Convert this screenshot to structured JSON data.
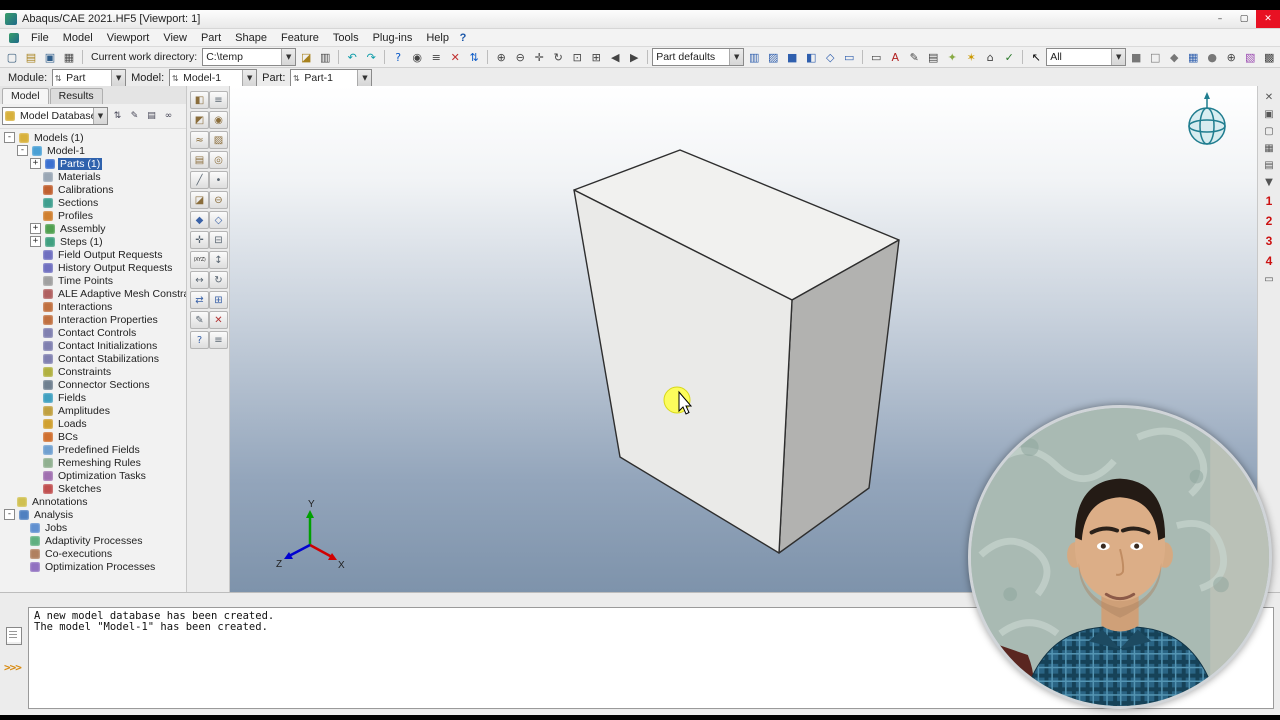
{
  "window": {
    "title": "Abaqus/CAE 2021.HF5 [Viewport: 1]",
    "buttons": {
      "minimize": "–",
      "maximize": "▢",
      "close": "✕"
    }
  },
  "menu": {
    "items": [
      "File",
      "Model",
      "Viewport",
      "View",
      "Part",
      "Shape",
      "Feature",
      "Tools",
      "Plug-ins",
      "Help"
    ],
    "help_glyph": "?"
  },
  "toolbar": {
    "work_dir_label": "Current work directory:",
    "work_dir_value": "C:\\temp",
    "render_combo": "Part defaults",
    "selection_combo": "All",
    "g1": [
      {
        "name": "new-model-icon",
        "glyph": "▢",
        "c": "#355a7a"
      },
      {
        "name": "open-model-icon",
        "glyph": "▤",
        "c": "#a8821e"
      },
      {
        "name": "save-model-icon",
        "glyph": "▣",
        "c": "#2e5d8a"
      },
      {
        "name": "print-icon",
        "glyph": "▦",
        "c": "#4a4a4a"
      }
    ],
    "g2": [
      {
        "name": "set-work-directory-icon",
        "glyph": "◪",
        "c": "#a8821e"
      },
      {
        "name": "print-viewport-icon",
        "glyph": "▥",
        "c": "#4a4a4a"
      }
    ],
    "g3": [
      {
        "name": "undo-icon",
        "glyph": "↶",
        "c": "#0a9ba8"
      },
      {
        "name": "redo-icon",
        "glyph": "↷",
        "c": "#0a9ba8"
      }
    ],
    "g4": [
      {
        "name": "query-icon",
        "glyph": "?",
        "c": "#0a5ac8"
      },
      {
        "name": "probe-icon",
        "glyph": "◉",
        "c": "#444444"
      },
      {
        "name": "reference-icon",
        "glyph": "≡",
        "c": "#444444"
      },
      {
        "name": "delete-icon",
        "glyph": "✕",
        "c": "#c03030"
      },
      {
        "name": "refresh-icon",
        "glyph": "⇅",
        "c": "#0a5ac8"
      }
    ],
    "g5": [
      {
        "name": "magnify-icon",
        "glyph": "⊕",
        "c": "#444444"
      },
      {
        "name": "demagnify-icon",
        "glyph": "⊖",
        "c": "#444444"
      },
      {
        "name": "pan-icon",
        "glyph": "✛",
        "c": "#444444"
      },
      {
        "name": "rotate-view-icon",
        "glyph": "↻",
        "c": "#444444"
      },
      {
        "name": "box-zoom-icon",
        "glyph": "⊡",
        "c": "#444444"
      },
      {
        "name": "fit-view-icon",
        "glyph": "⊞",
        "c": "#444444"
      },
      {
        "name": "cycle-prev-icon",
        "glyph": "◀",
        "c": "#444444"
      },
      {
        "name": "cycle-next-icon",
        "glyph": "▶",
        "c": "#444444"
      }
    ],
    "g6": [
      {
        "name": "wireframe-render-icon",
        "glyph": "▥",
        "c": "#2f5fae"
      },
      {
        "name": "hidden-render-icon",
        "glyph": "▨",
        "c": "#2f5fae"
      },
      {
        "name": "shaded-render-icon",
        "glyph": "■",
        "c": "#2f5fae"
      },
      {
        "name": "cut-view-icon",
        "glyph": "◧",
        "c": "#2f5fae"
      },
      {
        "name": "perspective-icon",
        "glyph": "◇",
        "c": "#2f5fae"
      },
      {
        "name": "parallel-icon",
        "glyph": "▭",
        "c": "#2f5fae"
      }
    ],
    "g7": [
      {
        "name": "viewport-icon",
        "glyph": "▭",
        "c": "#444444"
      },
      {
        "name": "annotation-icon",
        "glyph": "A",
        "c": "#b22222"
      },
      {
        "name": "text-icon",
        "glyph": "✎",
        "c": "#444444"
      },
      {
        "name": "overlay-icon",
        "glyph": "▤",
        "c": "#444444"
      },
      {
        "name": "sweep-icon",
        "glyph": "✦",
        "c": "#88aa44"
      },
      {
        "name": "lights-icon",
        "glyph": "✶",
        "c": "#cc9900"
      },
      {
        "name": "views-icon",
        "glyph": "⌂",
        "c": "#444444"
      },
      {
        "name": "snap-icon",
        "glyph": "✓",
        "c": "#2a7a2a"
      }
    ],
    "pointer": {
      "name": "pointer-icon",
      "glyph": "↖",
      "c": "#000000"
    },
    "g8": [
      {
        "name": "select-entity-icon",
        "glyph": "■",
        "c": "#777777"
      },
      {
        "name": "select-box-icon",
        "glyph": "□",
        "c": "#777777"
      },
      {
        "name": "select-angle-icon",
        "glyph": "◆",
        "c": "#777777"
      },
      {
        "name": "mesh-display-icon",
        "glyph": "▦",
        "c": "#2f5fae"
      },
      {
        "name": "highlight-icon",
        "glyph": "●",
        "c": "#777777"
      },
      {
        "name": "add-icon",
        "glyph": "⊕",
        "c": "#444444"
      },
      {
        "name": "color-code-icon",
        "glyph": "▧",
        "c": "#9a4ab0"
      },
      {
        "name": "pattern-icon",
        "glyph": "▩",
        "c": "#444444"
      },
      {
        "name": "plus-icon",
        "glyph": "✚",
        "c": "#2a7a2a"
      },
      {
        "name": "display-group-icon",
        "glyph": "▣",
        "c": "#555555"
      }
    ]
  },
  "modulebar": {
    "module_label": "Module:",
    "module_value": "Part",
    "model_label": "Model:",
    "model_value": "Model-1",
    "part_label": "Part:",
    "part_value": "Part-1"
  },
  "left_panel": {
    "tabs": [
      {
        "label": "Model",
        "active": "true"
      },
      {
        "label": "Results",
        "active": "false"
      }
    ],
    "db_combo": "Model Database",
    "header_icons": [
      {
        "name": "spin-icon",
        "glyph": "⇅"
      },
      {
        "name": "edit-icon",
        "glyph": "✎"
      },
      {
        "name": "options-icon",
        "glyph": "▤"
      },
      {
        "name": "search-icon",
        "glyph": "∞"
      }
    ],
    "tree": [
      {
        "label": "Models (1)",
        "depth": "0",
        "exp": "-",
        "icon": "models",
        "selected": "false"
      },
      {
        "label": "Model-1",
        "depth": "1",
        "exp": "-",
        "icon": "model",
        "selected": "false"
      },
      {
        "label": "Parts (1)",
        "depth": "2",
        "exp": "+",
        "icon": "parts",
        "selected": "true"
      },
      {
        "label": "Materials",
        "depth": "2",
        "exp": "",
        "icon": "materials",
        "selected": "false"
      },
      {
        "label": "Calibrations",
        "depth": "2",
        "exp": "",
        "icon": "calibrations",
        "selected": "false"
      },
      {
        "label": "Sections",
        "depth": "2",
        "exp": "",
        "icon": "sections",
        "selected": "false"
      },
      {
        "label": "Profiles",
        "depth": "2",
        "exp": "",
        "icon": "profiles",
        "selected": "false"
      },
      {
        "label": "Assembly",
        "depth": "2",
        "exp": "+",
        "icon": "assembly",
        "selected": "false"
      },
      {
        "label": "Steps (1)",
        "depth": "2",
        "exp": "+",
        "icon": "steps",
        "selected": "false"
      },
      {
        "label": "Field Output Requests",
        "depth": "2",
        "exp": "",
        "icon": "field-output",
        "selected": "false"
      },
      {
        "label": "History Output Requests",
        "depth": "2",
        "exp": "",
        "icon": "history-output",
        "selected": "false"
      },
      {
        "label": "Time Points",
        "depth": "2",
        "exp": "",
        "icon": "time-points",
        "selected": "false"
      },
      {
        "label": "ALE Adaptive Mesh Constraints",
        "depth": "2",
        "exp": "",
        "icon": "ale",
        "selected": "false"
      },
      {
        "label": "Interactions",
        "depth": "2",
        "exp": "",
        "icon": "interactions",
        "selected": "false"
      },
      {
        "label": "Interaction Properties",
        "depth": "2",
        "exp": "",
        "icon": "interaction-props",
        "selected": "false"
      },
      {
        "label": "Contact Controls",
        "depth": "2",
        "exp": "",
        "icon": "contact-controls",
        "selected": "false"
      },
      {
        "label": "Contact Initializations",
        "depth": "2",
        "exp": "",
        "icon": "contact-init",
        "selected": "false"
      },
      {
        "label": "Contact Stabilizations",
        "depth": "2",
        "exp": "",
        "icon": "contact-stab",
        "selected": "false"
      },
      {
        "label": "Constraints",
        "depth": "2",
        "exp": "",
        "icon": "constraints",
        "selected": "false"
      },
      {
        "label": "Connector Sections",
        "depth": "2",
        "exp": "",
        "icon": "connector-sections",
        "selected": "false"
      },
      {
        "label": "Fields",
        "depth": "2",
        "exp": "",
        "icon": "fields",
        "selected": "false"
      },
      {
        "label": "Amplitudes",
        "depth": "2",
        "exp": "",
        "icon": "amplitudes",
        "selected": "false"
      },
      {
        "label": "Loads",
        "depth": "2",
        "exp": "",
        "icon": "loads",
        "selected": "false"
      },
      {
        "label": "BCs",
        "depth": "2",
        "exp": "",
        "icon": "bcs",
        "selected": "false"
      },
      {
        "label": "Predefined Fields",
        "depth": "2",
        "exp": "",
        "icon": "predefined-fields",
        "selected": "false"
      },
      {
        "label": "Remeshing Rules",
        "depth": "2",
        "exp": "",
        "icon": "remeshing-rules",
        "selected": "false"
      },
      {
        "label": "Optimization Tasks",
        "depth": "2",
        "exp": "",
        "icon": "optimization-tasks",
        "selected": "false"
      },
      {
        "label": "Sketches",
        "depth": "2",
        "exp": "",
        "icon": "sketches",
        "selected": "false"
      },
      {
        "label": "Annotations",
        "depth": "0",
        "exp": "",
        "icon": "annotations",
        "selected": "false"
      },
      {
        "label": "Analysis",
        "depth": "0",
        "exp": "-",
        "icon": "analysis",
        "selected": "false"
      },
      {
        "label": "Jobs",
        "depth": "1",
        "exp": "",
        "icon": "jobs",
        "selected": "false"
      },
      {
        "label": "Adaptivity Processes",
        "depth": "1",
        "exp": "",
        "icon": "adaptivity",
        "selected": "false"
      },
      {
        "label": "Co-executions",
        "depth": "1",
        "exp": "",
        "icon": "co-executions",
        "selected": "false"
      },
      {
        "label": "Optimization Processes",
        "depth": "1",
        "exp": "",
        "icon": "optimization-processes",
        "selected": "false"
      }
    ]
  },
  "toolbox": {
    "tools": [
      {
        "name": "create-part-tool",
        "glyph": "◧",
        "c": "#8a6d3b"
      },
      {
        "name": "part-manager-tool",
        "glyph": "≡",
        "c": "#5a6672"
      },
      {
        "name": "solid-extrude-tool",
        "glyph": "◩",
        "c": "#8a6d3b"
      },
      {
        "name": "solid-revolve-tool",
        "glyph": "◉",
        "c": "#8a6d3b"
      },
      {
        "name": "solid-sweep-tool",
        "glyph": "≈",
        "c": "#8a6d3b"
      },
      {
        "name": "solid-loft-tool",
        "glyph": "▨",
        "c": "#8a6d3b"
      },
      {
        "name": "shell-extrude-tool",
        "glyph": "▤",
        "c": "#8a6d3b"
      },
      {
        "name": "shell-revolve-tool",
        "glyph": "◎",
        "c": "#8a6d3b"
      },
      {
        "name": "wire-tool",
        "glyph": "╱",
        "c": "#5a6672"
      },
      {
        "name": "point-tool",
        "glyph": "•",
        "c": "#5a6672"
      },
      {
        "name": "cut-extrude-tool",
        "glyph": "◪",
        "c": "#8a6d3b"
      },
      {
        "name": "cut-revolve-tool",
        "glyph": "⊖",
        "c": "#8a6d3b"
      },
      {
        "name": "round-fillet-tool",
        "glyph": "◆",
        "c": "#3a62a8"
      },
      {
        "name": "chamfer-tool",
        "glyph": "◇",
        "c": "#3a62a8"
      },
      {
        "name": "datum-tool",
        "glyph": "✛",
        "c": "#5a6672"
      },
      {
        "name": "partition-tool",
        "glyph": "⊟",
        "c": "#5a6672"
      },
      {
        "name": "datum-csys-tool",
        "glyph": "(XYZ)",
        "c": "#333333"
      },
      {
        "name": "datum-axis-tool",
        "glyph": "↕",
        "c": "#5a6672"
      },
      {
        "name": "translate-tool",
        "glyph": "↔",
        "c": "#5a6672"
      },
      {
        "name": "rotate-tool",
        "glyph": "↻",
        "c": "#5a6672"
      },
      {
        "name": "mirror-tool",
        "glyph": "⇄",
        "c": "#3a62a8"
      },
      {
        "name": "pattern-tool",
        "glyph": "⊞",
        "c": "#3a62a8"
      },
      {
        "name": "edit-feature-tool",
        "glyph": "✎",
        "c": "#5a6672"
      },
      {
        "name": "delete-feature-tool",
        "glyph": "✕",
        "c": "#b33333"
      },
      {
        "name": "query-tool",
        "glyph": "?",
        "c": "#3a62a8"
      },
      {
        "name": "options-tool",
        "glyph": "≡",
        "c": "#5a6672"
      }
    ]
  },
  "viewport": {
    "triad": {
      "x": "X",
      "y": "Y",
      "z": "Z"
    }
  },
  "right_toolbar": {
    "icons_top": [
      {
        "name": "close-icon",
        "glyph": "✕"
      },
      {
        "name": "pin-icon",
        "glyph": "▣"
      },
      {
        "name": "maximize-viewport-icon",
        "glyph": "▢"
      },
      {
        "name": "tile-icon",
        "glyph": "▦"
      },
      {
        "name": "cascade-icon",
        "glyph": "▤"
      },
      {
        "name": "arrow-down-icon",
        "glyph": "▼"
      }
    ],
    "numbers": [
      "1",
      "2",
      "3",
      "4"
    ],
    "icons_bottom": [
      {
        "name": "viewport-state-icon",
        "glyph": "▭"
      }
    ]
  },
  "messages": {
    "lines": [
      "A new model database has been created.",
      "The model \"Model-1\" has been created."
    ],
    "prompt": ">>>"
  }
}
